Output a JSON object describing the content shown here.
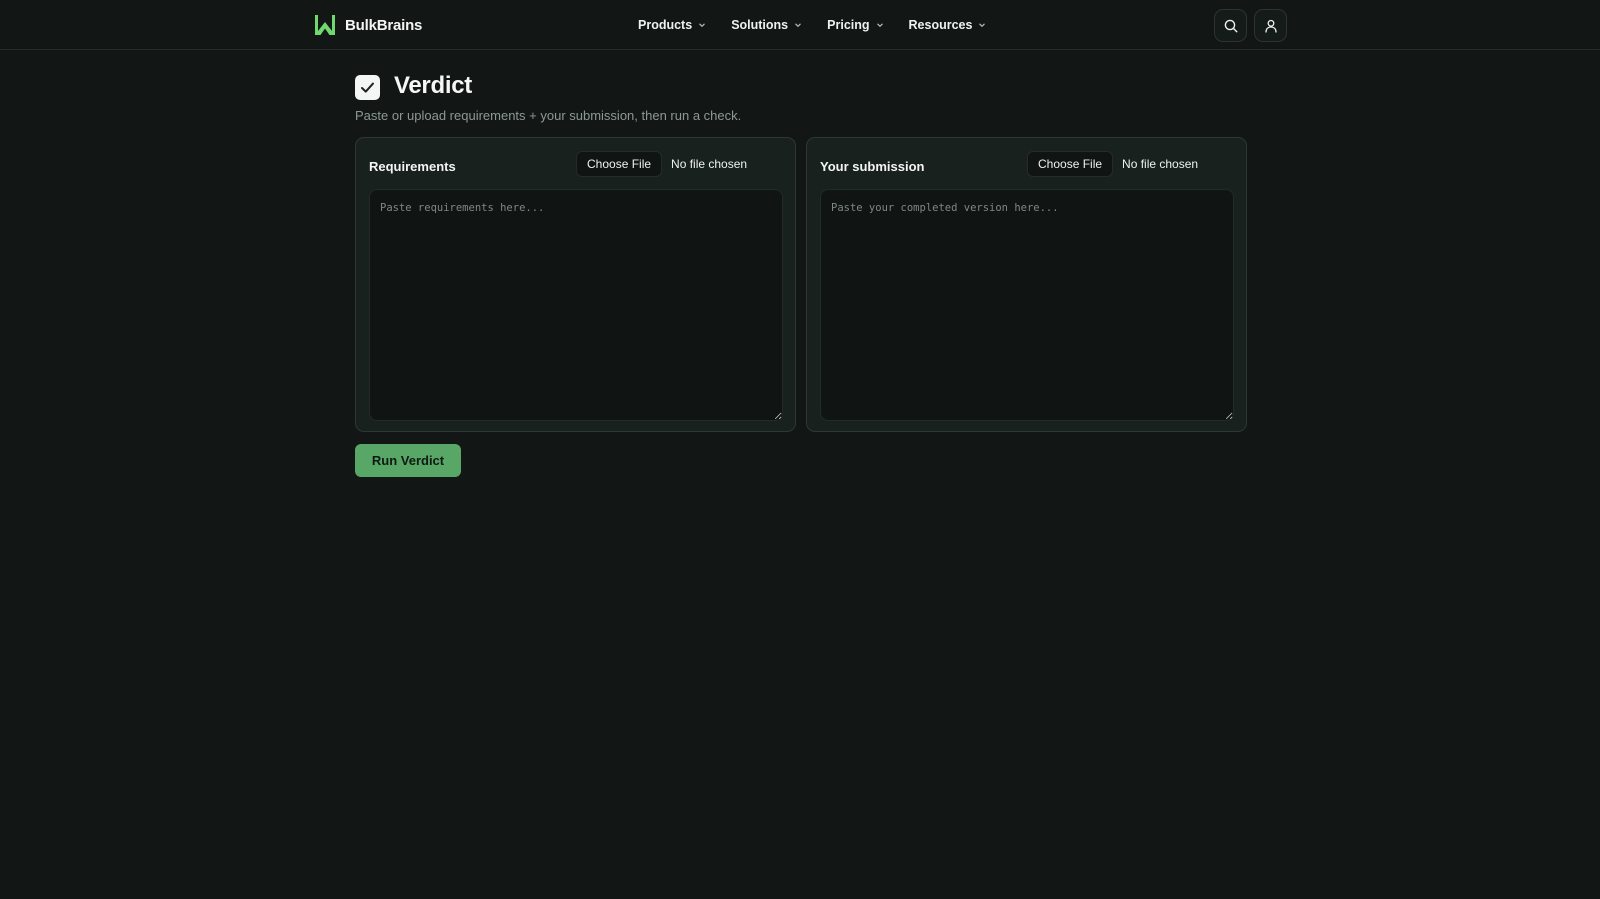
{
  "brand": {
    "name": "BulkBrains",
    "accent": "#6fd96f"
  },
  "nav": {
    "items": [
      {
        "label": "Products",
        "icon": "chevron-down-icon"
      },
      {
        "label": "Solutions",
        "icon": "chevron-down-icon"
      },
      {
        "label": "Pricing",
        "icon": "chevron-down-icon"
      },
      {
        "label": "Resources",
        "icon": "chevron-down-icon"
      }
    ],
    "actions": [
      {
        "icon": "search-icon"
      },
      {
        "icon": "user-icon"
      }
    ]
  },
  "page": {
    "title": "Verdict",
    "title_icon": "checkbox-check-icon",
    "subtitle": "Paste or upload requirements + your submission, then run a check."
  },
  "panels": {
    "requirements": {
      "title": "Requirements",
      "file_button": "Choose File",
      "file_status": "No file chosen",
      "placeholder": "Paste requirements here...",
      "value": ""
    },
    "submission": {
      "title": "Your submission",
      "file_button": "Choose File",
      "file_status": "No file chosen",
      "placeholder": "Paste your completed version here...",
      "value": ""
    }
  },
  "actions": {
    "run_label": "Run Verdict",
    "run_color": "#58a766"
  },
  "colors": {
    "background": "#121716",
    "panel": "#19211e",
    "input": "#101513"
  }
}
